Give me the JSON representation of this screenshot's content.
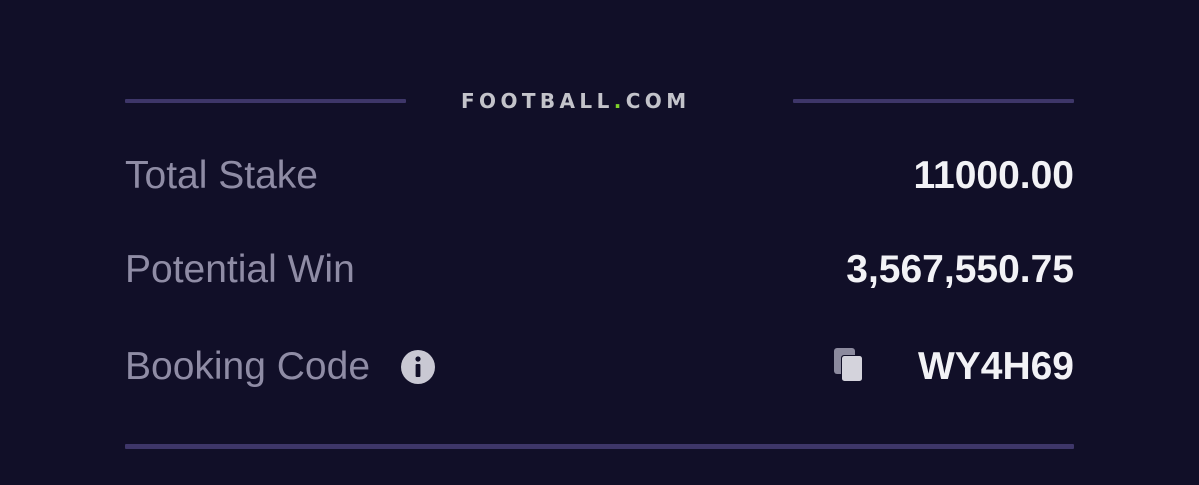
{
  "brand": {
    "name_part1": "FOOTBALL",
    "name_dot": ".",
    "name_part2": "COM",
    "dot_color": "#7fd22a"
  },
  "summary": {
    "total_stake": {
      "label": "Total Stake",
      "value": "11000.00"
    },
    "potential_win": {
      "label": "Potential Win",
      "value": "3,567,550.75"
    },
    "booking_code": {
      "label": "Booking Code",
      "value": "WY4H69",
      "info_icon": "info-icon",
      "copy_icon": "copy-icon"
    }
  },
  "colors": {
    "background": "#110f28",
    "divider": "#3e3669",
    "label": "#8f8ca5",
    "value": "#f2f2f6"
  }
}
